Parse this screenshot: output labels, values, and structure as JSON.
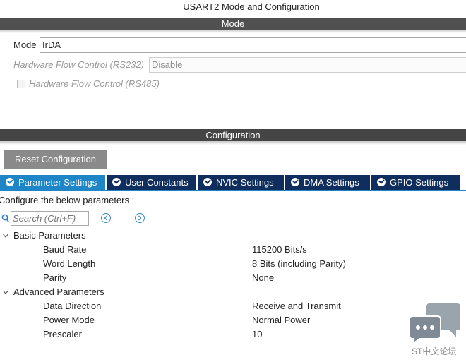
{
  "window": {
    "title": "USART2 Mode and Configuration"
  },
  "mode_section": {
    "header": "Mode",
    "mode": {
      "label": "Mode",
      "value": "IrDA"
    },
    "hw_flow_rs232": {
      "label": "Hardware Flow Control (RS232)",
      "value": "Disable"
    },
    "hw_flow_rs485": {
      "label": "Hardware Flow Control (RS485)",
      "checked": false
    }
  },
  "config_section": {
    "header": "Configuration",
    "reset_button": "Reset Configuration",
    "tabs": [
      {
        "label": "Parameter Settings",
        "active": true
      },
      {
        "label": "User Constants",
        "active": false
      },
      {
        "label": "NVIC Settings",
        "active": false
      },
      {
        "label": "DMA Settings",
        "active": false
      },
      {
        "label": "GPIO Settings",
        "active": false
      }
    ],
    "configure_text": "Configure the below parameters :",
    "search": {
      "placeholder": "Search (Ctrl+F)"
    },
    "groups": [
      {
        "name": "Basic Parameters",
        "params": [
          {
            "label": "Baud Rate",
            "value": "115200 Bits/s"
          },
          {
            "label": "Word Length",
            "value": "8 Bits (including Parity)"
          },
          {
            "label": "Parity",
            "value": "None"
          }
        ]
      },
      {
        "name": "Advanced Parameters",
        "params": [
          {
            "label": "Data Direction",
            "value": "Receive and Transmit"
          },
          {
            "label": "Power Mode",
            "value": "Normal Power"
          },
          {
            "label": "Prescaler",
            "value": "10"
          }
        ]
      }
    ]
  },
  "watermark": {
    "text": "ST中文论坛"
  },
  "colors": {
    "section_header_bg": "#4a4a4a",
    "tab_bg": "#0f2e5e",
    "tab_active_bg": "#1e86c7",
    "reset_button_bg": "#8a8a8a",
    "logo": "#9aa4ad"
  }
}
